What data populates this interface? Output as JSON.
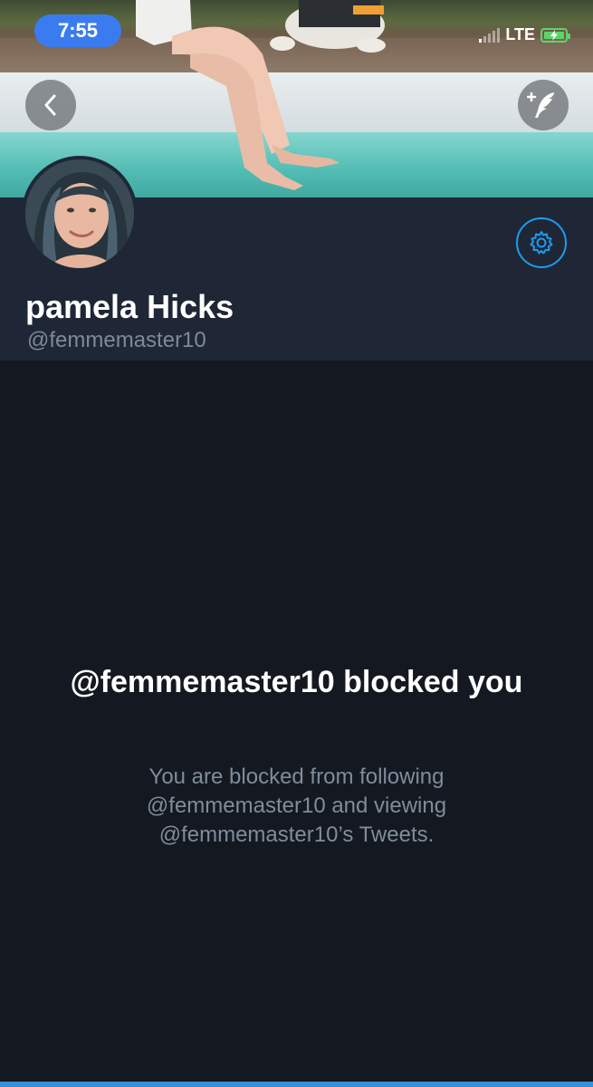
{
  "status_bar": {
    "time": "7:55",
    "network": "LTE",
    "icons": [
      "signal-icon",
      "battery-charging-icon"
    ]
  },
  "header": {
    "back_icon": "chevron-left-icon",
    "compose_icon": "compose-tweet-icon",
    "settings_icon": "gear-icon"
  },
  "profile": {
    "display_name": "pamela Hicks",
    "handle": "@femmemaster10"
  },
  "blocked": {
    "title": "@femmemaster10 blocked you",
    "description": "You are blocked from following @femmemaster10 and viewing @femmemaster10’s Tweets."
  },
  "colors": {
    "background": "#141921",
    "header_background": "#1f2736",
    "accent": "#1d9bf0",
    "time_pill": "#3a7cf0",
    "muted_text": "#7f8c9b"
  }
}
